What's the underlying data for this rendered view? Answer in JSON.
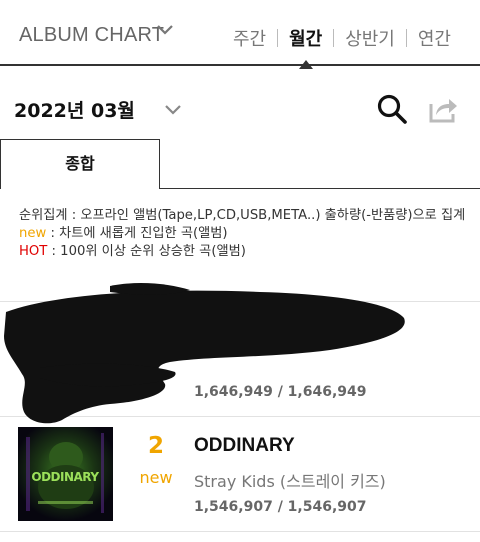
{
  "header": {
    "chart_title": "ALBUM CHART",
    "tabs": [
      {
        "label": "주간",
        "active": false
      },
      {
        "label": "월간",
        "active": true
      },
      {
        "label": "상반기",
        "active": false
      },
      {
        "label": "연간",
        "active": false
      }
    ]
  },
  "date_selector": {
    "label": "2022년 03월"
  },
  "category_tab": {
    "label": "종합"
  },
  "legend": {
    "line1": "순위집계 : 오프라인 앨범(Tape,LP,CD,USB,META..) 출하량(-반품량)으로 집계",
    "new_keyword": "new",
    "new_desc": " : 차트에 새롭게 진입한 곡(앨범)",
    "hot_keyword": "HOT",
    "hot_desc": " : 100위 이상 순위 상승한 곡(앨범)"
  },
  "chart_rows": [
    {
      "rank": "",
      "change": "",
      "title": "",
      "artist": "",
      "sales": "1,646,949 / 1,646,949"
    },
    {
      "rank": "2",
      "change": "new",
      "title": "ODDINARY",
      "artist": "Stray Kids (스트레이 키즈)",
      "sales": "1,546,907 / 1,546,907"
    }
  ],
  "colors": {
    "accent": "#f0a500",
    "hot": "#e00000",
    "text_dark": "#111111",
    "text_muted": "#777777"
  }
}
